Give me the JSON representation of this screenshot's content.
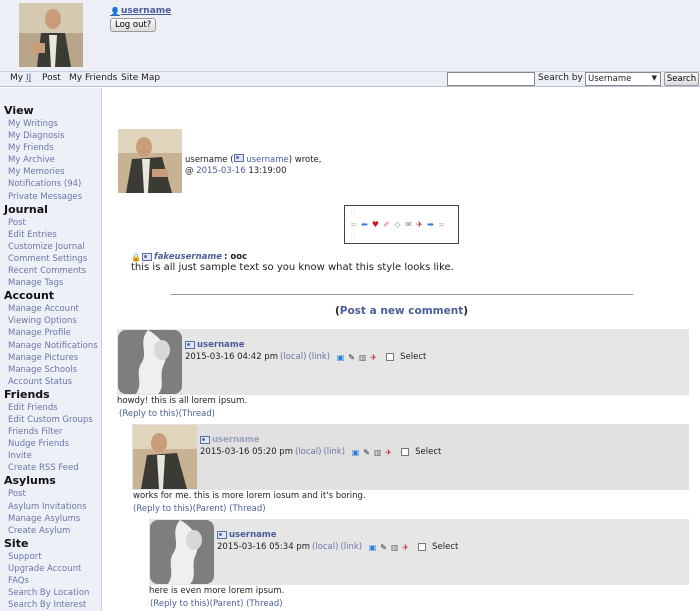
{
  "header": {
    "username": "username",
    "logout_label": "Log out?"
  },
  "navbar": {
    "items": [
      "My ",
      "Post",
      "My Friends",
      "Site Map"
    ],
    "myij_suffix": "IJ",
    "search_by_label": "Search by :",
    "search_select_value": "Username",
    "search_button": "Search"
  },
  "sidebar": {
    "sections": [
      {
        "title": "View",
        "items": [
          "My Writings",
          "My Diagnosis",
          "My Friends",
          "My Archive",
          "My Memories",
          "Notifications (94)",
          "Private Messages"
        ]
      },
      {
        "title": "Journal",
        "items": [
          "Post",
          "Edit Entries",
          "Customize Journal",
          "Comment Settings",
          "Recent Comments",
          "Manage Tags"
        ]
      },
      {
        "title": "Account",
        "items": [
          "Manage Account",
          "Viewing Options",
          "Manage Profile",
          "Manage Notifications",
          "Manage Pictures",
          "Manage Schools",
          "Account Status"
        ]
      },
      {
        "title": "Friends",
        "items": [
          "Edit Friends",
          "Edit Custom Groups",
          "Friends Filter",
          "Nudge Friends",
          "Invite",
          "Create RSS Feed"
        ]
      },
      {
        "title": "Asylums",
        "items": [
          "Post",
          "Asylum Invitations",
          "Manage Asylums",
          "Create Asylum"
        ]
      },
      {
        "title": "Site",
        "items": [
          "Support",
          "Upgrade Account",
          "FAQs",
          "Search By Location",
          "Search By Interest"
        ]
      }
    ]
  },
  "entry": {
    "author": "username",
    "poster": "username",
    "wrote": "wrote,",
    "at": "@",
    "date": "2015-03-16",
    "time": "13:19:00",
    "ooc_user": "fakeusername",
    "ooc_tag": ": ooc",
    "text": "this is all just sample text so you know what this style looks like."
  },
  "post_comment": {
    "open": "(",
    "label": "Post a new comment",
    "close": ")"
  },
  "comments": [
    {
      "user": "username",
      "date": "2015-03-16 04:42 pm",
      "local": "(local)",
      "link": "(link)",
      "select": "Select",
      "body": "howdy! this is all lorem ipsum.",
      "reply": "(Reply to this)",
      "thread": "(Thread)",
      "parent": ""
    },
    {
      "user": "username",
      "date": "2015-03-16 05:20 pm",
      "local": "(local)",
      "link": "(link)",
      "select": "Select",
      "body": "works for me. this is more lorem iosum and it's boring.",
      "reply": "(Reply to this)",
      "parent": "(Parent)",
      "thread": "(Thread)"
    },
    {
      "user": "username",
      "date": "2015-03-16 05:34 pm",
      "local": "(local)",
      "link": "(link)",
      "select": "Select",
      "body": "here is even more lorem ipsum.",
      "reply": "(Reply to this)",
      "parent": "(Parent)",
      "thread": "(Thread)"
    }
  ],
  "colors": {
    "link": "#4a5f9a",
    "sidebar_bg": "#eef0f8",
    "header_bg": "#eceff6",
    "comment_bg": "#e6e6e6"
  }
}
